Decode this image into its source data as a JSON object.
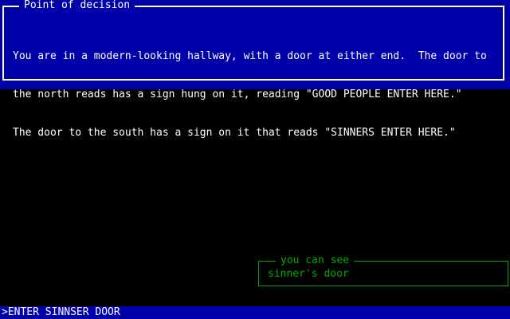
{
  "room": {
    "title": "Point of decision",
    "description_lines": [
      "You are in a modern-looking hallway, with a door at either end.  The door to",
      "the north reads has a sign hung on it, reading \"GOOD PEOPLE ENTER HERE.\"",
      "The door to the south has a sign on it that reads \"SINNERS ENTER HERE.\""
    ]
  },
  "visible_items": {
    "title": "you can see",
    "items": [
      "sinner's door"
    ]
  },
  "command": {
    "value": ">ENTER SINNSER DOOR"
  },
  "colors": {
    "panel_blue": "#0000a8",
    "text_white": "#ffffff",
    "text_green": "#00a800",
    "background": "#000000"
  }
}
